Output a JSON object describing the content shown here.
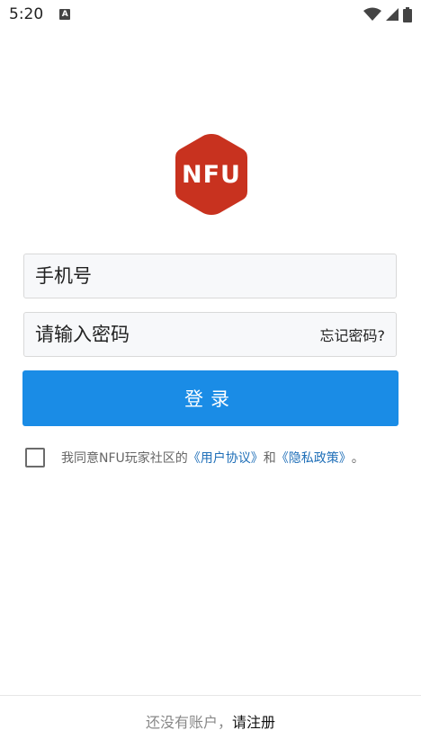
{
  "status_bar": {
    "time": "5:20",
    "notification_icon_letter": "A",
    "icons": [
      "wifi-icon",
      "signal-icon",
      "battery-icon"
    ]
  },
  "logo": {
    "text": "NFU",
    "color": "#c8321f"
  },
  "form": {
    "phone_placeholder": "手机号",
    "password_placeholder": "请输入密码",
    "forgot_label": "忘记密码?",
    "login_label": "登录"
  },
  "agreement": {
    "checked": false,
    "prefix": "我同意NFU玩家社区的",
    "user_agreement": "《用户协议》",
    "and": "和",
    "privacy_policy": "《隐私政策》",
    "suffix": "。"
  },
  "footer": {
    "prompt": "还没有账户，",
    "register_label": "请注册"
  },
  "colors": {
    "primary_button": "#1a8ce6",
    "link": "#1f6fb8"
  }
}
